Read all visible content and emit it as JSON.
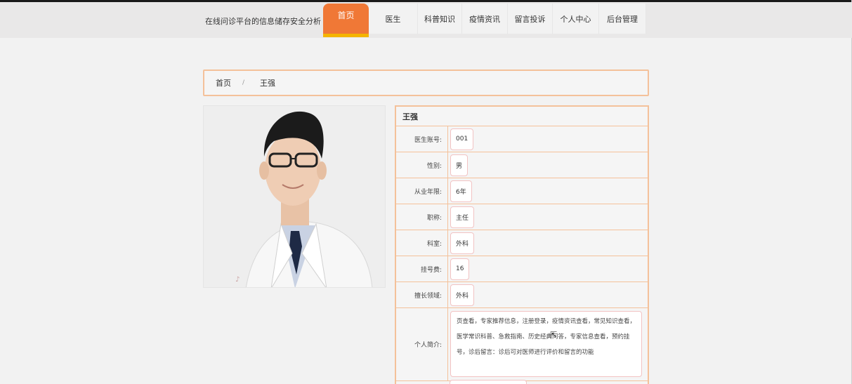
{
  "header": {
    "site_title": "在线问诊平台的信息储存安全分析",
    "nav": [
      {
        "label": "首页",
        "active": true
      },
      {
        "label": "医生"
      },
      {
        "label": "科普知识"
      },
      {
        "label": "疫情资讯"
      },
      {
        "label": "留言投诉"
      },
      {
        "label": "个人中心"
      },
      {
        "label": "后台管理"
      }
    ]
  },
  "breadcrumb": {
    "home": "首页",
    "separator": "/",
    "current": "王强"
  },
  "doctor": {
    "name": "王强",
    "photo_icon": "doctor-portrait",
    "fields": [
      {
        "label": "医生账号:",
        "value": "001"
      },
      {
        "label": "性别:",
        "value": "男"
      },
      {
        "label": "从业年限:",
        "value": "6年"
      },
      {
        "label": "职称:",
        "value": "主任"
      },
      {
        "label": "科室:",
        "value": "外科"
      },
      {
        "label": "挂号费:",
        "value": "16"
      },
      {
        "label": "擅长领域:",
        "value": "外科"
      }
    ],
    "bio_label": "个人简介:",
    "bio_text": "页查看，专家推荐信息，注册登录，疫情资讯查看，常见知识查看，医学常识科普、急救指南、历史经典问答，专家信息查看，预约挂号，诊后留言：诊后可对医师进行评价和留言的功能"
  },
  "colors": {
    "accent": "#f07836",
    "accent_underline": "#f4b400",
    "border": "#f4c19a"
  }
}
